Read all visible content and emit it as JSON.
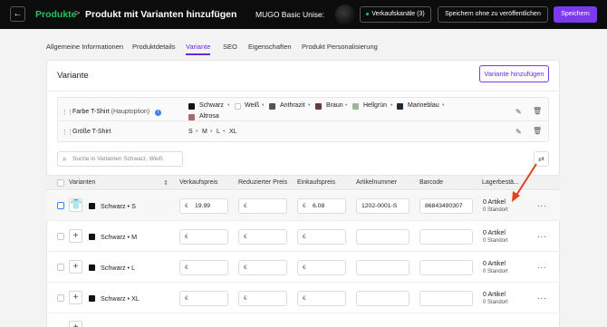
{
  "topbar": {
    "back_label": "←",
    "breadcrumb_root": "Produkte",
    "breadcrumb_sep": ">",
    "page_title": "Produkt mit Varianten hinzufügen",
    "store_name": "MUGO Basic Unise:",
    "channels_label": "Verkaufskanäle (3)",
    "save_draft_label": "Speichern ohne zu veröffentlichen",
    "save_label": "Speichern"
  },
  "tabs": [
    "Allgemeine Informationen",
    "Produktdetails",
    "Variante",
    "SEO",
    "Eigenschaften",
    "Produkt Personalisierung"
  ],
  "variant_section": {
    "title": "Variante",
    "add_button": "Variante hinzufügen",
    "options": [
      {
        "name": "Farbe T-Shirt",
        "suffix": "(Hauptoption)",
        "values": [
          {
            "label": "Schwarz",
            "color": "#111111"
          },
          {
            "label": "Weiß",
            "color": "#ffffff"
          },
          {
            "label": "Anthrazit",
            "color": "#555555"
          },
          {
            "label": "Braun",
            "color": "#6b3a3a"
          },
          {
            "label": "Hellgrün",
            "color": "#9fb59a"
          },
          {
            "label": "Marineblau",
            "color": "#1e2a3a"
          },
          {
            "label": "Altrosa",
            "color": "#a86a6a"
          }
        ]
      },
      {
        "name": "Größe T-Shirt",
        "values": [
          {
            "label": "S"
          },
          {
            "label": "M"
          },
          {
            "label": "L"
          },
          {
            "label": "XL"
          }
        ]
      }
    ],
    "search_placeholder": "Suche in Varianten Schwarz, Weiß"
  },
  "table": {
    "headers": [
      "Varianten",
      "Verkaufspreis",
      "Reduzierter Preis",
      "Einkaufspreis",
      "Artikelnummer",
      "Barcode",
      "Lagerbestä..."
    ],
    "currency": "€",
    "rows": [
      {
        "color": "Schwarz",
        "size": "S",
        "price": "19.99",
        "reduced": "",
        "purchase": "6.08",
        "sku": "1202-0001-S",
        "barcode": "86843490307",
        "stock": "0 Artikel",
        "location": "0 Standort"
      },
      {
        "color": "Schwarz",
        "size": "M",
        "price": "",
        "reduced": "",
        "purchase": "",
        "sku": "",
        "barcode": "",
        "stock": "0 Artikel",
        "location": "0 Standort"
      },
      {
        "color": "Schwarz",
        "size": "L",
        "price": "",
        "reduced": "",
        "purchase": "",
        "sku": "",
        "barcode": "",
        "stock": "0 Artikel",
        "location": "0 Standort"
      },
      {
        "color": "Schwarz",
        "size": "XL",
        "price": "",
        "reduced": "",
        "purchase": "",
        "sku": "",
        "barcode": "",
        "stock": "0 Artikel",
        "location": "0 Standort"
      }
    ]
  },
  "colors": {
    "accent": "#7c3aed",
    "brand_green": "#22c55e",
    "annotation_arrow": "#e53e1e"
  }
}
